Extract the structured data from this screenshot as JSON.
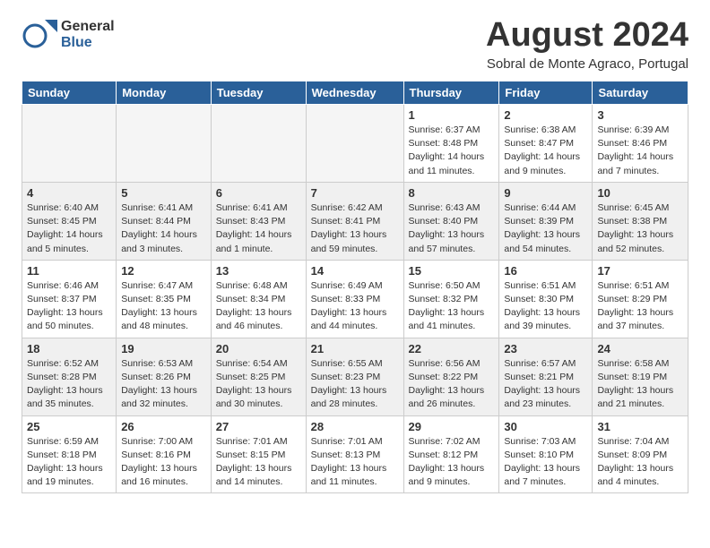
{
  "header": {
    "logo_general": "General",
    "logo_blue": "Blue",
    "month_title": "August 2024",
    "location": "Sobral de Monte Agraco, Portugal"
  },
  "calendar": {
    "headers": [
      "Sunday",
      "Monday",
      "Tuesday",
      "Wednesday",
      "Thursday",
      "Friday",
      "Saturday"
    ],
    "rows": [
      [
        {
          "day": "",
          "empty": true
        },
        {
          "day": "",
          "empty": true
        },
        {
          "day": "",
          "empty": true
        },
        {
          "day": "",
          "empty": true
        },
        {
          "day": "1",
          "info": "Sunrise: 6:37 AM\nSunset: 8:48 PM\nDaylight: 14 hours\nand 11 minutes."
        },
        {
          "day": "2",
          "info": "Sunrise: 6:38 AM\nSunset: 8:47 PM\nDaylight: 14 hours\nand 9 minutes."
        },
        {
          "day": "3",
          "info": "Sunrise: 6:39 AM\nSunset: 8:46 PM\nDaylight: 14 hours\nand 7 minutes."
        }
      ],
      [
        {
          "day": "4",
          "info": "Sunrise: 6:40 AM\nSunset: 8:45 PM\nDaylight: 14 hours\nand 5 minutes."
        },
        {
          "day": "5",
          "info": "Sunrise: 6:41 AM\nSunset: 8:44 PM\nDaylight: 14 hours\nand 3 minutes."
        },
        {
          "day": "6",
          "info": "Sunrise: 6:41 AM\nSunset: 8:43 PM\nDaylight: 14 hours\nand 1 minute."
        },
        {
          "day": "7",
          "info": "Sunrise: 6:42 AM\nSunset: 8:41 PM\nDaylight: 13 hours\nand 59 minutes."
        },
        {
          "day": "8",
          "info": "Sunrise: 6:43 AM\nSunset: 8:40 PM\nDaylight: 13 hours\nand 57 minutes."
        },
        {
          "day": "9",
          "info": "Sunrise: 6:44 AM\nSunset: 8:39 PM\nDaylight: 13 hours\nand 54 minutes."
        },
        {
          "day": "10",
          "info": "Sunrise: 6:45 AM\nSunset: 8:38 PM\nDaylight: 13 hours\nand 52 minutes."
        }
      ],
      [
        {
          "day": "11",
          "info": "Sunrise: 6:46 AM\nSunset: 8:37 PM\nDaylight: 13 hours\nand 50 minutes."
        },
        {
          "day": "12",
          "info": "Sunrise: 6:47 AM\nSunset: 8:35 PM\nDaylight: 13 hours\nand 48 minutes."
        },
        {
          "day": "13",
          "info": "Sunrise: 6:48 AM\nSunset: 8:34 PM\nDaylight: 13 hours\nand 46 minutes."
        },
        {
          "day": "14",
          "info": "Sunrise: 6:49 AM\nSunset: 8:33 PM\nDaylight: 13 hours\nand 44 minutes."
        },
        {
          "day": "15",
          "info": "Sunrise: 6:50 AM\nSunset: 8:32 PM\nDaylight: 13 hours\nand 41 minutes."
        },
        {
          "day": "16",
          "info": "Sunrise: 6:51 AM\nSunset: 8:30 PM\nDaylight: 13 hours\nand 39 minutes."
        },
        {
          "day": "17",
          "info": "Sunrise: 6:51 AM\nSunset: 8:29 PM\nDaylight: 13 hours\nand 37 minutes."
        }
      ],
      [
        {
          "day": "18",
          "info": "Sunrise: 6:52 AM\nSunset: 8:28 PM\nDaylight: 13 hours\nand 35 minutes."
        },
        {
          "day": "19",
          "info": "Sunrise: 6:53 AM\nSunset: 8:26 PM\nDaylight: 13 hours\nand 32 minutes."
        },
        {
          "day": "20",
          "info": "Sunrise: 6:54 AM\nSunset: 8:25 PM\nDaylight: 13 hours\nand 30 minutes."
        },
        {
          "day": "21",
          "info": "Sunrise: 6:55 AM\nSunset: 8:23 PM\nDaylight: 13 hours\nand 28 minutes."
        },
        {
          "day": "22",
          "info": "Sunrise: 6:56 AM\nSunset: 8:22 PM\nDaylight: 13 hours\nand 26 minutes."
        },
        {
          "day": "23",
          "info": "Sunrise: 6:57 AM\nSunset: 8:21 PM\nDaylight: 13 hours\nand 23 minutes."
        },
        {
          "day": "24",
          "info": "Sunrise: 6:58 AM\nSunset: 8:19 PM\nDaylight: 13 hours\nand 21 minutes."
        }
      ],
      [
        {
          "day": "25",
          "info": "Sunrise: 6:59 AM\nSunset: 8:18 PM\nDaylight: 13 hours\nand 19 minutes."
        },
        {
          "day": "26",
          "info": "Sunrise: 7:00 AM\nSunset: 8:16 PM\nDaylight: 13 hours\nand 16 minutes."
        },
        {
          "day": "27",
          "info": "Sunrise: 7:01 AM\nSunset: 8:15 PM\nDaylight: 13 hours\nand 14 minutes."
        },
        {
          "day": "28",
          "info": "Sunrise: 7:01 AM\nSunset: 8:13 PM\nDaylight: 13 hours\nand 11 minutes."
        },
        {
          "day": "29",
          "info": "Sunrise: 7:02 AM\nSunset: 8:12 PM\nDaylight: 13 hours\nand 9 minutes."
        },
        {
          "day": "30",
          "info": "Sunrise: 7:03 AM\nSunset: 8:10 PM\nDaylight: 13 hours\nand 7 minutes."
        },
        {
          "day": "31",
          "info": "Sunrise: 7:04 AM\nSunset: 8:09 PM\nDaylight: 13 hours\nand 4 minutes."
        }
      ]
    ]
  }
}
